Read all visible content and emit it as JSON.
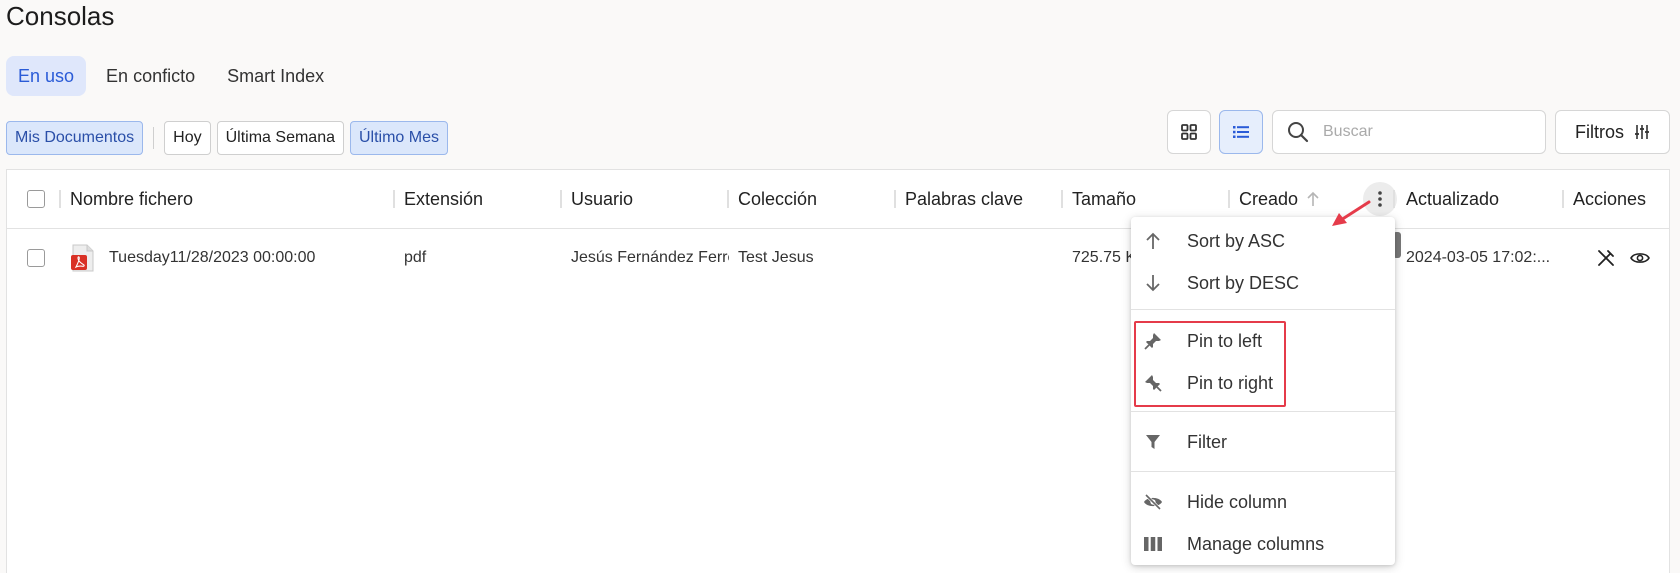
{
  "page": {
    "title": "Consolas"
  },
  "tabs": [
    {
      "label": "En uso",
      "active": true
    },
    {
      "label": "En conficto",
      "active": false
    },
    {
      "label": "Smart Index",
      "active": false
    }
  ],
  "chips": [
    {
      "label": "Mis Documentos",
      "selected": true
    },
    {
      "label": "Hoy",
      "selected": false
    },
    {
      "label": "Última Semana",
      "selected": false
    },
    {
      "label": "Último Mes",
      "selected": true
    }
  ],
  "toolbar": {
    "grid_view_icon": "grid-view-icon",
    "list_view_icon": "list-view-icon",
    "search_placeholder": "Buscar",
    "search_value": "",
    "filters_label": "Filtros"
  },
  "table": {
    "columns": [
      "Nombre fichero",
      "Extensión",
      "Usuario",
      "Colección",
      "Palabras clave",
      "Tamaño",
      "Creado",
      "Actualizado",
      "Acciones"
    ],
    "rows": [
      {
        "name": "Tuesday11/28/2023 00:00:00",
        "extension": "pdf",
        "user": "Jesús Fernández Ferre",
        "collection": "Test Jesus",
        "keywords": "",
        "size": "725.75 K",
        "created": "",
        "updated": "2024-03-05 17:02:..."
      }
    ]
  },
  "column_menu": {
    "items": [
      {
        "label": "Sort by ASC",
        "icon": "arrow-up-icon"
      },
      {
        "label": "Sort by DESC",
        "icon": "arrow-down-icon"
      },
      {
        "label": "Pin to left",
        "icon": "pin-left-icon"
      },
      {
        "label": "Pin to right",
        "icon": "pin-right-icon"
      },
      {
        "label": "Filter",
        "icon": "funnel-icon"
      },
      {
        "label": "Hide column",
        "icon": "eye-off-icon"
      },
      {
        "label": "Manage columns",
        "icon": "columns-icon"
      }
    ]
  },
  "colors": {
    "accent": "#2a5bd7",
    "accent_bg": "#dfe7fb",
    "annotation_red": "#e53b4a",
    "pdf_red": "#d93025"
  }
}
